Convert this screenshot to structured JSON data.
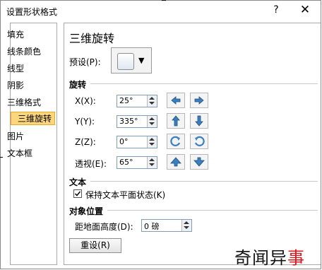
{
  "window": {
    "title": "设置形状格式",
    "help_label": "?",
    "close_label": "✕"
  },
  "sidebar": {
    "items": [
      {
        "label": "填充"
      },
      {
        "label": "线条颜色"
      },
      {
        "label": "线型"
      },
      {
        "label": "阴影"
      },
      {
        "label": "三维格式"
      },
      {
        "label": "三维旋转",
        "selected": true
      },
      {
        "label": "图片"
      },
      {
        "label": "文本框"
      }
    ]
  },
  "main": {
    "heading": "三维旋转",
    "preset_label": "预设(P):",
    "preset_arrow": "▼",
    "rotation": {
      "section": "旋转",
      "x": {
        "label": "X(X):",
        "value": "25°"
      },
      "y": {
        "label": "Y(Y):",
        "value": "335°"
      },
      "z": {
        "label": "Z(Z):",
        "value": "0°"
      },
      "perspective": {
        "label": "透视(E):",
        "value": "65°"
      }
    },
    "text": {
      "section": "文本",
      "keep_flat_label": "保持文本平面状态(K)",
      "keep_flat_checked": true
    },
    "position": {
      "section": "对象位置",
      "distance_label": "距地面高度(D):",
      "distance_value": "0 磅"
    },
    "reset_label": "重设(R)"
  },
  "watermark": {
    "text_black": "奇闻异",
    "text_red": "事"
  },
  "icons": {
    "rotate_left": "rotate-left-icon",
    "rotate_right": "rotate-right-icon",
    "rotate_up": "rotate-up-icon",
    "rotate_down": "rotate-down-icon",
    "rotate_ccw": "rotate-counterclockwise-icon",
    "rotate_cw": "rotate-clockwise-icon",
    "persp_increase": "perspective-increase-icon",
    "persp_decrease": "perspective-decrease-icon"
  },
  "colors": {
    "selected_bg": "#fbd67c",
    "selected_border": "#e9a824",
    "icon_blue": "#3a7fc1",
    "watermark_red": "#e0151a"
  }
}
